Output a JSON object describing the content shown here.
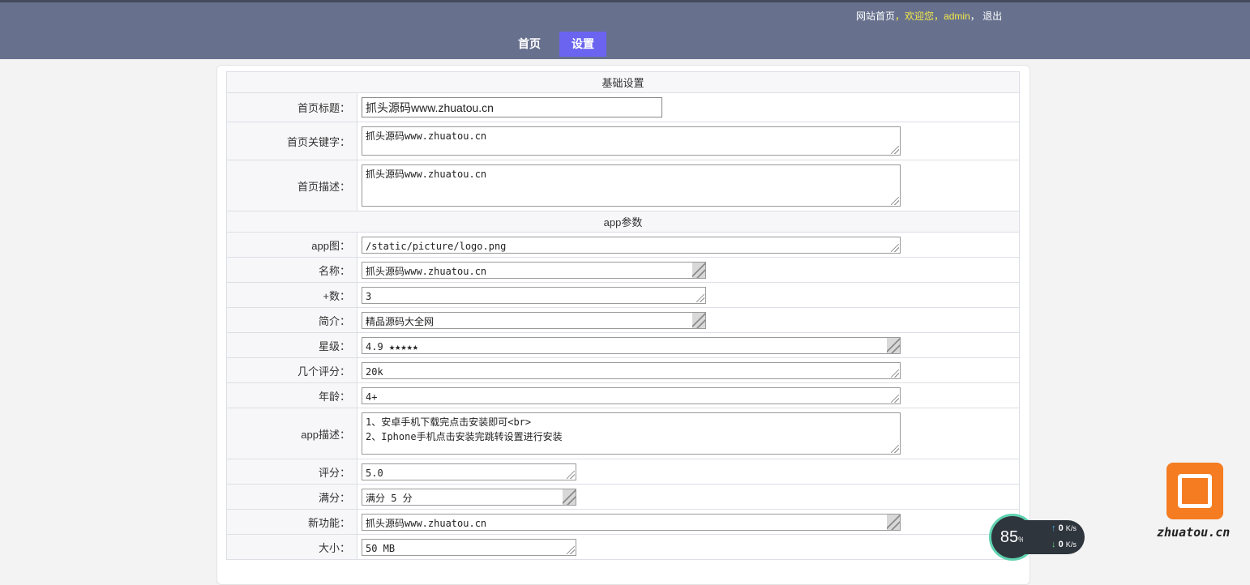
{
  "header": {
    "links": {
      "site_home": "网站首页",
      "sep1": "，",
      "welcome": "欢迎您",
      "sep2": "，",
      "user": "admin",
      "sep3": "，",
      "logout": "退出"
    },
    "nav": [
      {
        "label": "首页",
        "active": false
      },
      {
        "label": "设置",
        "active": true
      }
    ],
    "accent_color": "#6a64f0",
    "bar_color": "#67718e"
  },
  "form": {
    "section_basic": "基础设置",
    "section_app": "app参数",
    "basic": [
      {
        "label": "首页标题：",
        "value": "抓头源码www.zhuatou.cn"
      },
      {
        "label": "首页关键字：",
        "value": "抓头源码www.zhuatou.cn"
      },
      {
        "label": "首页描述：",
        "value": "抓头源码www.zhuatou.cn"
      }
    ],
    "app": [
      {
        "label": "app图：",
        "value": "/static/picture/logo.png"
      },
      {
        "label": "名称：",
        "value": "抓头源码www.zhuatou.cn"
      },
      {
        "label": "+数：",
        "value": "3"
      },
      {
        "label": "简介：",
        "value": "精品源码大全网"
      },
      {
        "label": "星级：",
        "value": "4.9 ★★★★★"
      },
      {
        "label": "几个评分：",
        "value": "20k"
      },
      {
        "label": "年龄：",
        "value": "4+"
      },
      {
        "label": "app描述：",
        "value": "1、安卓手机下载完点击安装即可<br>\n2、Iphone手机点击安装完跳转设置进行安装"
      },
      {
        "label": "评分：",
        "value": "5.0"
      },
      {
        "label": "满分：",
        "value": "满分 5 分"
      },
      {
        "label": "新功能：",
        "value": "抓头源码www.zhuatou.cn"
      },
      {
        "label": "大小：",
        "value": "50 MB"
      }
    ]
  },
  "overlay": {
    "gauge_value": "85",
    "gauge_unit": "%",
    "upload": "0",
    "download": "0",
    "speed_unit": "K/s",
    "watermark": "zhuatou.cn"
  }
}
